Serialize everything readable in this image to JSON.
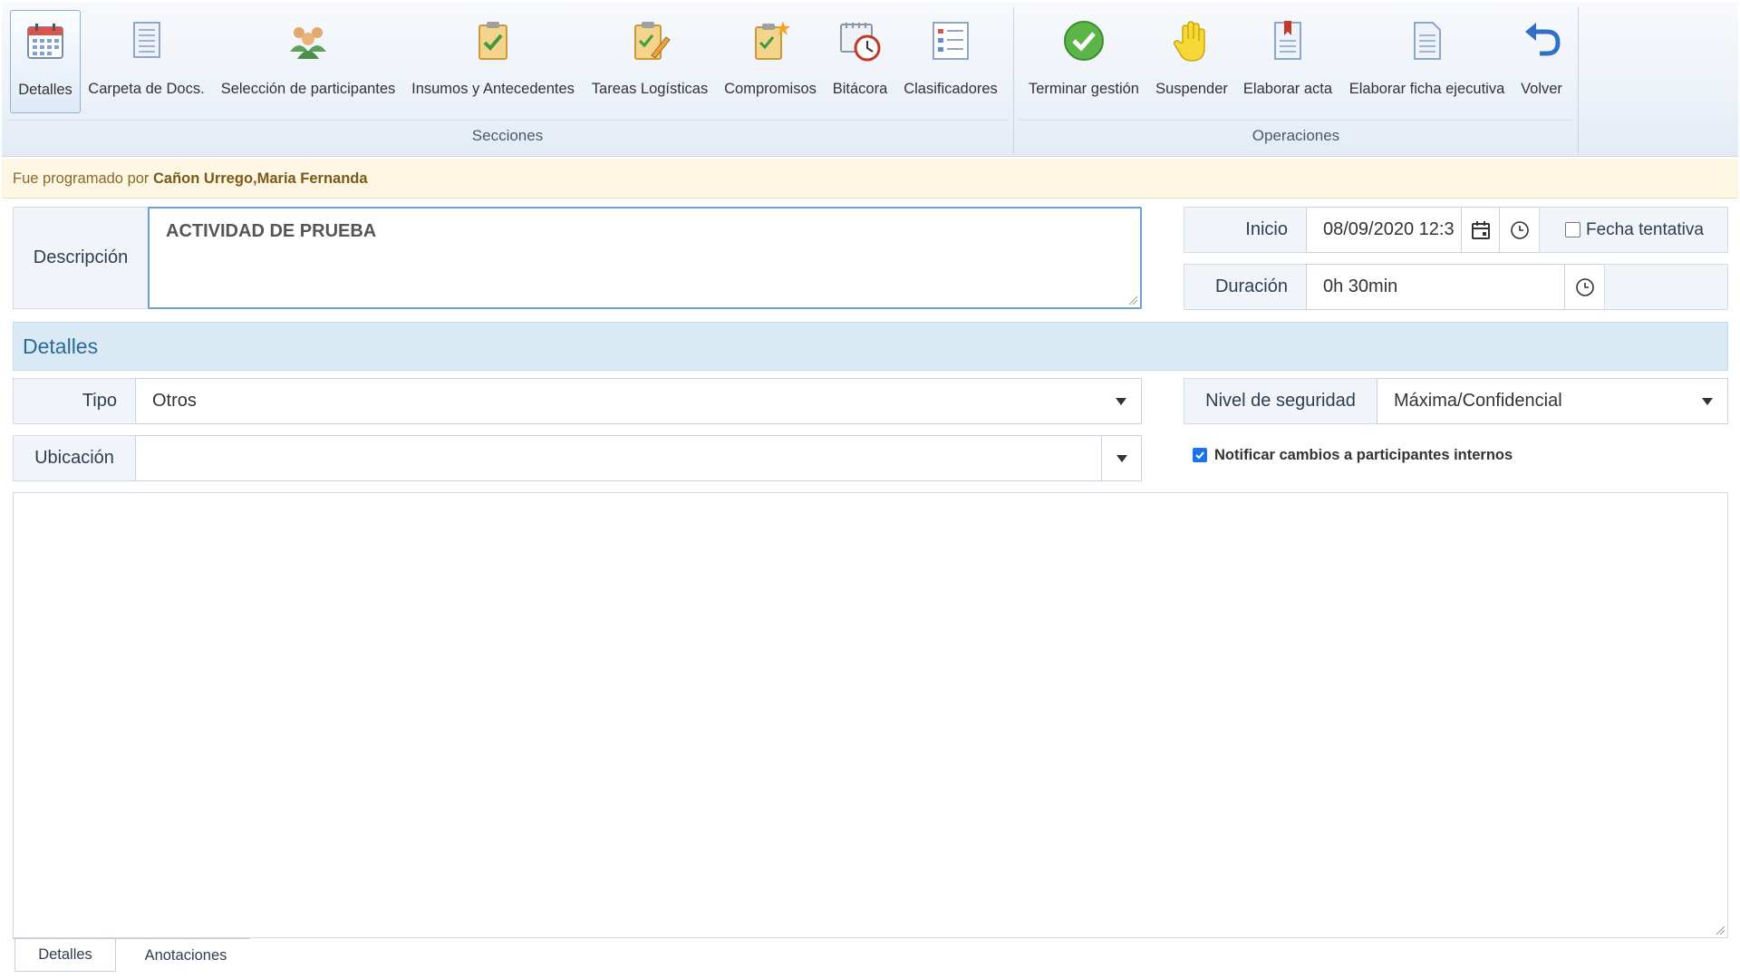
{
  "ribbon": {
    "sections_label": "Secciones",
    "operations_label": "Operaciones",
    "sections": [
      {
        "label": "Detalles",
        "icon": "calendar-icon"
      },
      {
        "label": "Carpeta de Docs.",
        "icon": "document-icon"
      },
      {
        "label": "Selección de participantes",
        "icon": "users-group-icon"
      },
      {
        "label": "Insumos y Antecedentes",
        "icon": "clipboard-check-icon"
      },
      {
        "label": "Tareas Logísticas",
        "icon": "clipboard-pencil-icon"
      },
      {
        "label": "Compromisos",
        "icon": "clipboard-star-icon"
      },
      {
        "label": "Bitácora",
        "icon": "clock-log-icon"
      },
      {
        "label": "Clasificadores",
        "icon": "list-icon"
      }
    ],
    "operations": [
      {
        "label": "Terminar gestión",
        "icon": "check-circle-icon"
      },
      {
        "label": "Suspender",
        "icon": "hand-stop-icon"
      },
      {
        "label": "Elaborar acta",
        "icon": "bookmark-document-icon"
      },
      {
        "label": "Elaborar ficha ejecutiva",
        "icon": "file-icon"
      },
      {
        "label": "Volver",
        "icon": "undo-arrow-icon"
      }
    ]
  },
  "notice": {
    "prefix": "Fue programado por",
    "name": "Cañon Urrego,Maria Fernanda"
  },
  "form": {
    "descripcion_label": "Descripción",
    "descripcion_value": "ACTIVIDAD DE PRUEBA",
    "inicio_label": "Inicio",
    "inicio_value": "08/09/2020 12:3",
    "fecha_tentativa_label": "Fecha tentativa",
    "fecha_tentativa_checked": false,
    "duracion_label": "Duración",
    "duracion_value": "0h 30min",
    "detalles_header": "Detalles",
    "tipo_label": "Tipo",
    "tipo_value": "Otros",
    "nivel_label": "Nivel de seguridad",
    "nivel_value": "Máxima/Confidencial",
    "ubicacion_label": "Ubicación",
    "ubicacion_value": "",
    "notificar_label": "Notificar cambios a participantes internos",
    "notificar_checked": true
  },
  "tabs": [
    "Detalles",
    "Anotaciones"
  ],
  "colors": {
    "accent": "#2a6b96",
    "header_bg": "#d9eaf5",
    "notice_bg": "#fdf6e3"
  }
}
